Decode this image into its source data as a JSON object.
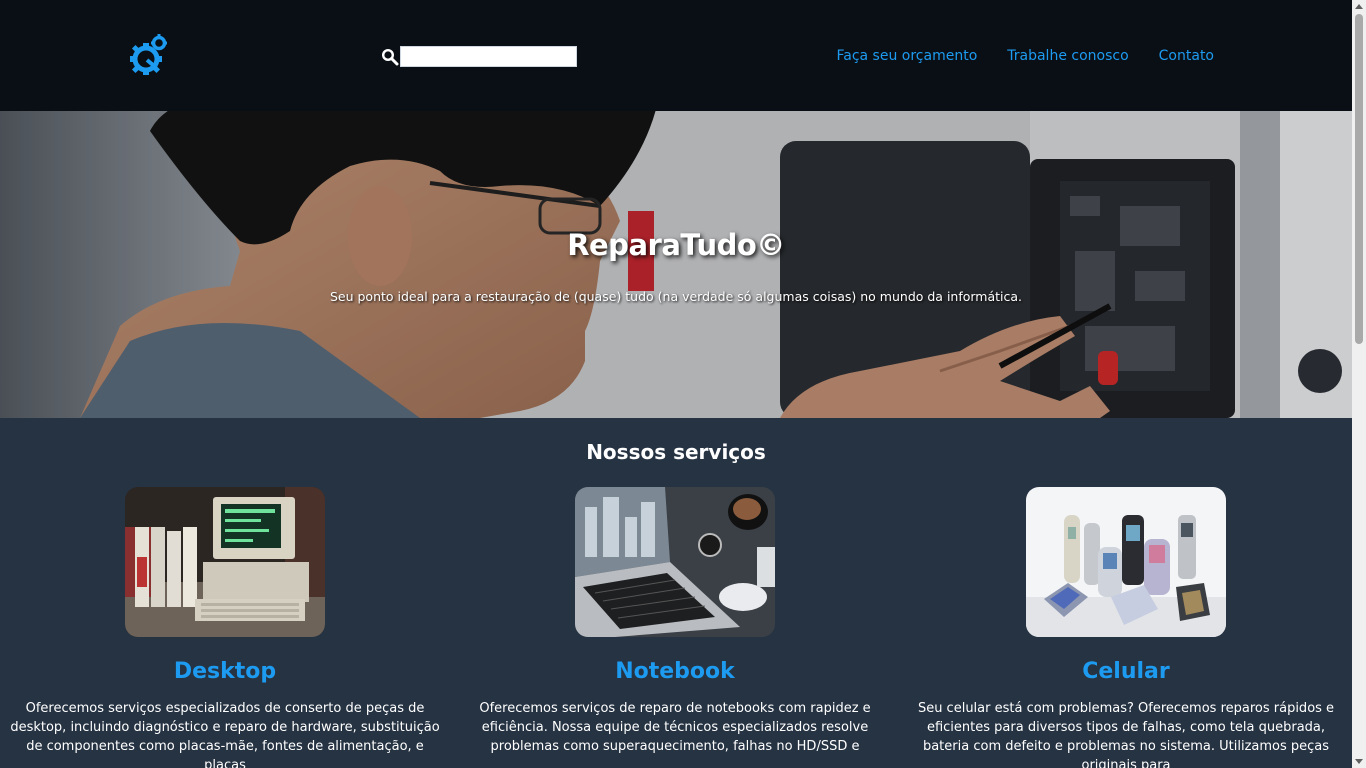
{
  "header": {
    "logo_icon": "gear-q-logo-icon",
    "search": {
      "icon": "search-icon",
      "placeholder": "",
      "value": ""
    },
    "nav": [
      {
        "label": "Faça seu orçamento"
      },
      {
        "label": "Trabalhe conosco"
      },
      {
        "label": "Contato"
      }
    ]
  },
  "hero": {
    "title": "ReparaTudo©",
    "subtitle": "Seu ponto ideal para a restauração de (quase) tudo (na verdade só algumas coisas) no mundo da informática."
  },
  "services": {
    "title": "Nossos serviços",
    "items": [
      {
        "image": "desktop-computer-image",
        "title": "Desktop",
        "text": "Oferecemos serviços especializados de conserto de peças de desktop, incluindo diagnóstico e reparo de hardware, substituição de componentes como placas-mãe, fontes de alimentação, e placas"
      },
      {
        "image": "notebook-image",
        "title": "Notebook",
        "text": "Oferecemos serviços de reparo de notebooks com rapidez e eficiência. Nossa equipe de técnicos especializados resolve problemas como superaquecimento, falhas no HD/SSD e"
      },
      {
        "image": "cellphones-image",
        "title": "Celular",
        "text": "Seu celular está com problemas? Oferecemos reparos rápidos e eficientes para diversos tipos de falhas, como tela quebrada, bateria com defeito e problemas no sistema. Utilizamos peças originais para"
      }
    ]
  },
  "colors": {
    "header_bg": "#0a0f15",
    "page_bg": "#263343",
    "accent": "#1d9bf0"
  }
}
